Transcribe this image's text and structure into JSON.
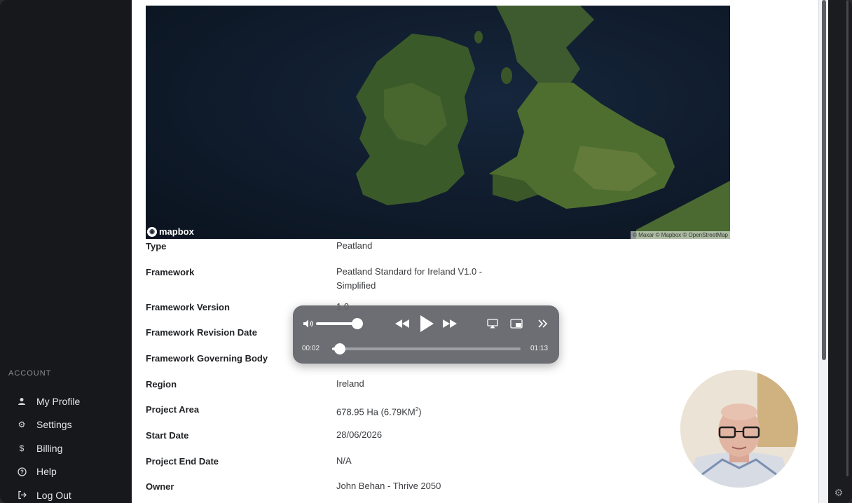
{
  "sidebar": {
    "section_label": "ACCOUNT",
    "items": [
      {
        "label": "My Profile",
        "icon": "user-icon"
      },
      {
        "label": "Settings",
        "icon": "gear-icon"
      },
      {
        "label": "Billing",
        "icon": "dollar-icon"
      },
      {
        "label": "Help",
        "icon": "help-icon"
      },
      {
        "label": "Log Out",
        "icon": "logout-icon"
      }
    ]
  },
  "map": {
    "logo_text": "mapbox",
    "attribution": "© Maxar © Mapbox © OpenStreetMap"
  },
  "details": [
    {
      "label": "Type",
      "value": "Peatland"
    },
    {
      "label": "Framework",
      "value": "Peatland Standard for Ireland V1.0 -",
      "value2": "Simplified"
    },
    {
      "label": "Framework Version",
      "value": "1.0"
    },
    {
      "label": "Framework Revision Date",
      "value": ""
    },
    {
      "label": "Framework Governing Body",
      "value": ""
    },
    {
      "label": "Region",
      "value": "Ireland"
    },
    {
      "label": "Project Area",
      "value": "678.95 Ha (6.79KM",
      "sup": "2",
      "value_suffix": ")"
    },
    {
      "label": "Start Date",
      "value": "28/06/2026"
    },
    {
      "label": "Project End Date",
      "value": "N/A"
    },
    {
      "label": "Owner",
      "value": "John Behan - Thrive 2050"
    }
  ],
  "player": {
    "current_time": "00:02",
    "duration": "01:13",
    "progress_fraction": 0.027,
    "volume_fraction": 0.85
  },
  "colors": {
    "sidebar_bg": "#17181b",
    "content_bg": "#ffffff",
    "player_bg": "#606267"
  }
}
